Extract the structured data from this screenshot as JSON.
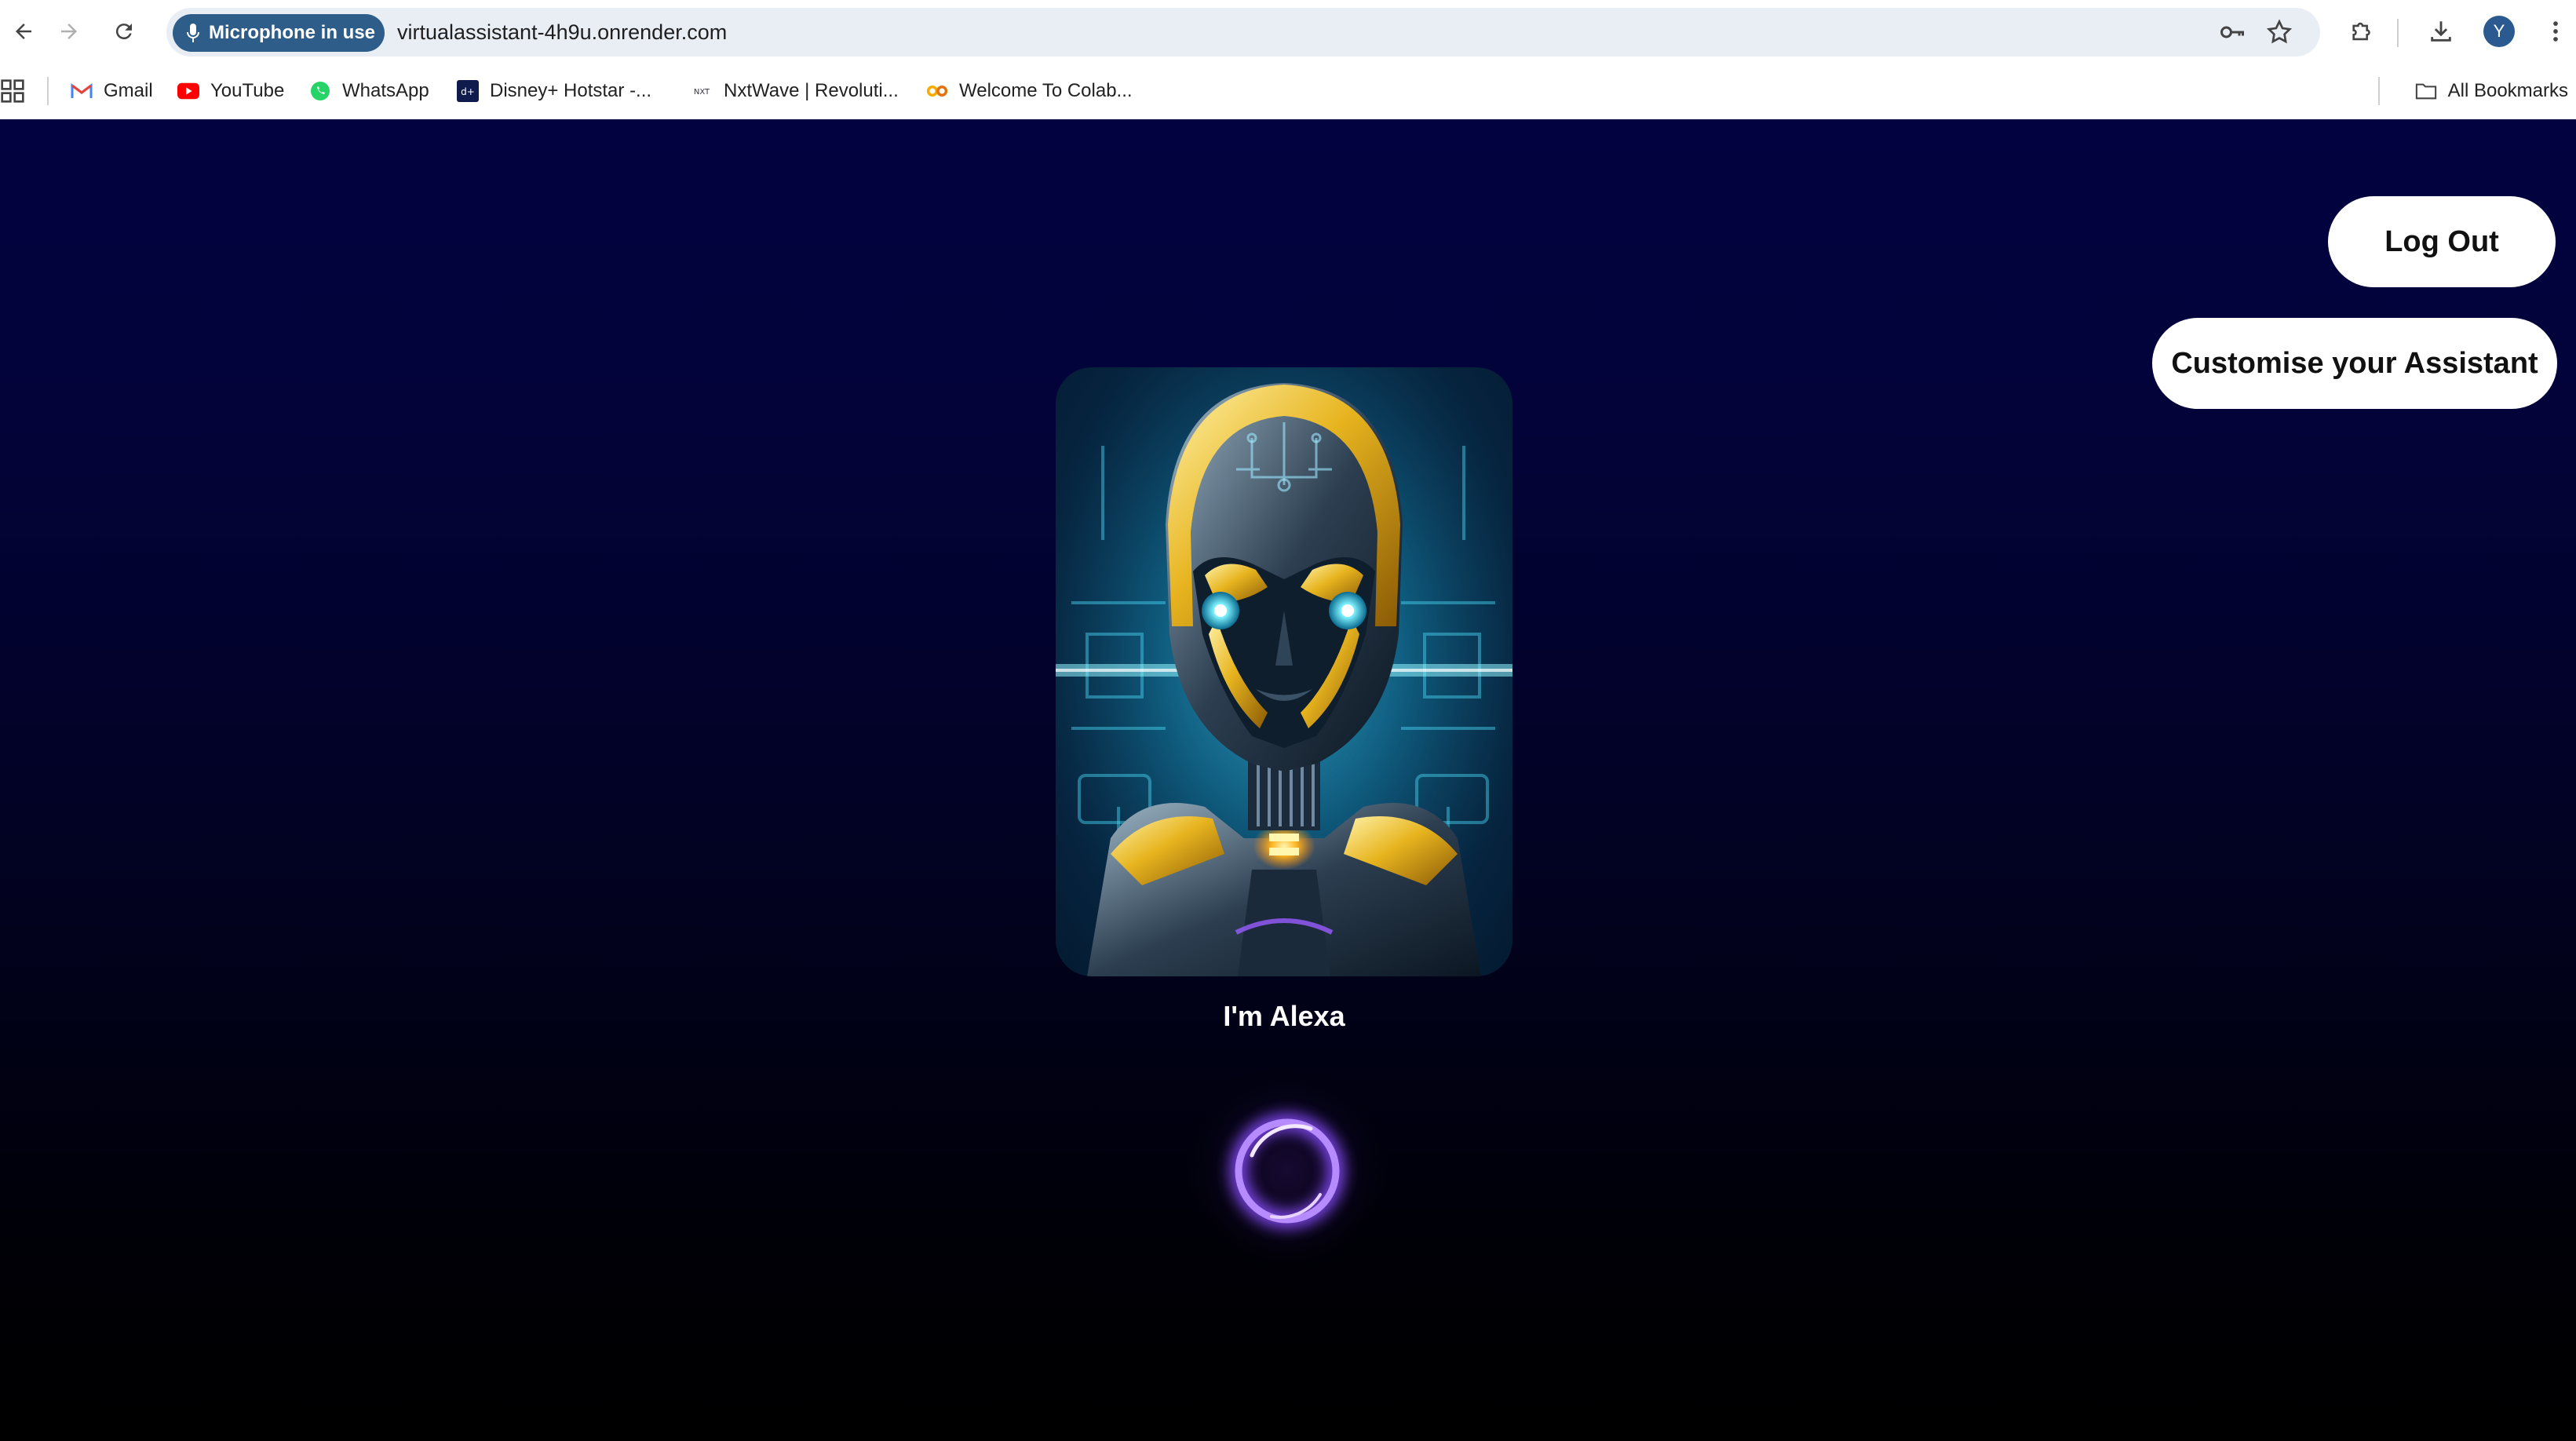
{
  "browser": {
    "mic_chip_label": "Microphone in use",
    "url": "virtualassistant-4h9u.onrender.com",
    "profile_initial": "Y"
  },
  "bookmarks": {
    "items": [
      {
        "label": "Gmail",
        "icon": "gmail-icon"
      },
      {
        "label": "YouTube",
        "icon": "youtube-icon"
      },
      {
        "label": "WhatsApp",
        "icon": "whatsapp-icon"
      },
      {
        "label": "Disney+ Hotstar -...",
        "icon": "hotstar-icon"
      },
      {
        "label": "NxtWave | Revoluti...",
        "icon": "nxtwave-icon"
      },
      {
        "label": "Welcome To Colab...",
        "icon": "colab-icon"
      }
    ],
    "all_bookmarks_label": "All Bookmarks"
  },
  "page": {
    "logout_label": "Log Out",
    "customise_label": "Customise your Assistant",
    "assistant_name": "I'm Alexa",
    "assistant_image": "robot-portrait-image",
    "status_indicator": "listening-orb"
  },
  "colors": {
    "background_top": "#020240",
    "background_bottom": "#000000",
    "button_bg": "#ffffff",
    "orb_glow": "#8a4dff",
    "mic_chip_bg": "#2d5d88"
  }
}
